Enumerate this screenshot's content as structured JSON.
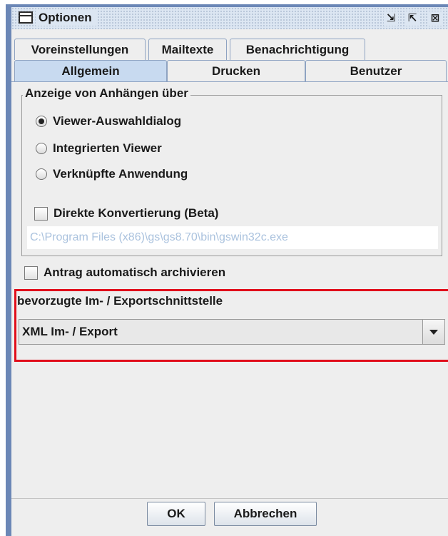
{
  "window": {
    "title": "Optionen",
    "buttons": {
      "minimize_glyph": "⇲",
      "maximize_glyph": "⇱",
      "close_glyph": "⊠"
    }
  },
  "tabs": {
    "row1": [
      "Voreinstellungen",
      "Mailtexte",
      "Benachrichtigung"
    ],
    "row2": [
      "Allgemein",
      "Drucken",
      "Benutzer"
    ],
    "active": "Allgemein"
  },
  "attachments": {
    "legend": "Anzeige von Anhängen über",
    "options": [
      "Viewer-Auswahldialog",
      "Integrierten Viewer",
      "Verknüpfte Anwendung"
    ],
    "selected": "Viewer-Auswahldialog",
    "direct_conversion_label": "Direkte Konvertierung (Beta)",
    "direct_conversion_checked": false,
    "path_value": "C:\\Program Files (x86)\\gs\\gs8.70\\bin\\gswin32c.exe"
  },
  "auto_archive": {
    "label": "Antrag automatisch archivieren",
    "checked": false
  },
  "interface": {
    "label": "bevorzugte Im- / Exportschnittstelle",
    "selected": "XML Im- / Export"
  },
  "footer": {
    "ok": "OK",
    "cancel": "Abbrechen"
  },
  "colors": {
    "highlight": "#e10e1b",
    "active_tab": "#c8daf0",
    "frame": "#6b87b6"
  }
}
